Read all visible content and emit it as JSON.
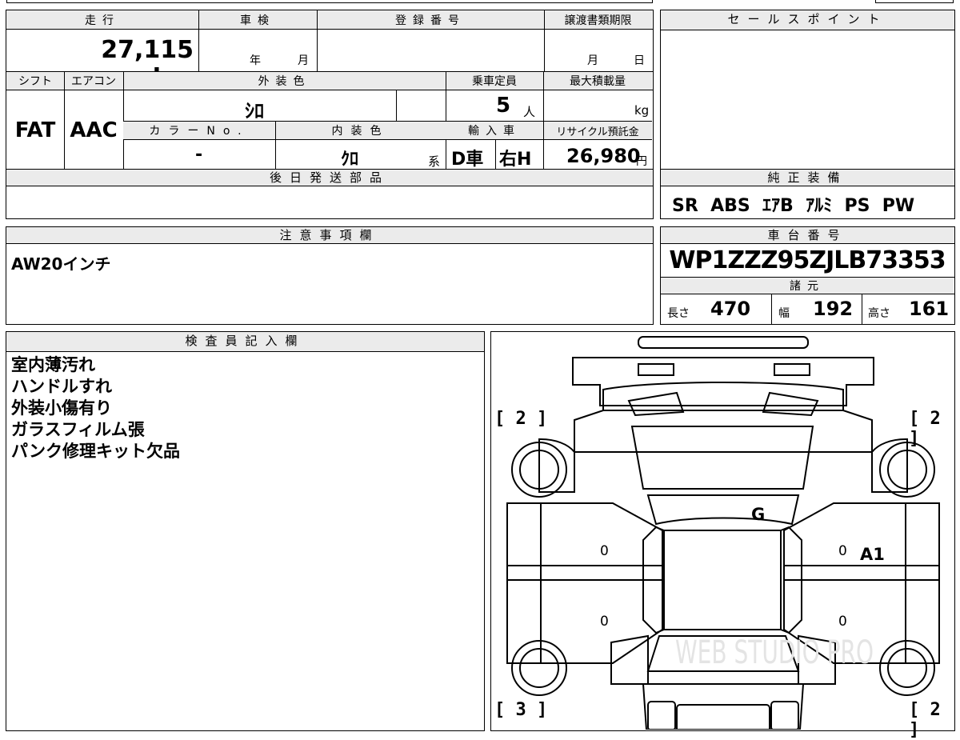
{
  "headers": {
    "mileage": "走行",
    "inspection": "車検",
    "registration_no": "登録番号",
    "transfer_deadline": "譲渡書類期限",
    "sales_points": "セールスポイント",
    "shift": "シフト",
    "aircon": "エアコン",
    "exterior_color": "外装色",
    "capacity": "乗車定員",
    "max_load": "最大積載量",
    "color_no": "カラーNo.",
    "interior_color": "内装色",
    "import": "輸入車",
    "recycle": "リサイクル預託金",
    "later_parts": "後日発送部品",
    "genuine_equipment": "純正装備",
    "notes": "注意事項欄",
    "chassis_no": "車台番号",
    "specs": "諸元",
    "inspector": "検査員記入欄"
  },
  "vehicle": {
    "mileage": "27,115 km",
    "inspection_year_unit": "年",
    "inspection_month_unit": "月",
    "deadline_month_unit": "月",
    "deadline_day_unit": "日",
    "shift": "FAT",
    "aircon": "AAC",
    "exterior_color": "ｼﾛ",
    "capacity": "5",
    "capacity_unit": "人",
    "max_load_unit": "kg",
    "color_no": "-",
    "interior_color": "ｸﾛ",
    "interior_suffix": "系",
    "import_type": "D車",
    "steering": "右H",
    "recycle_fee": "26,980",
    "recycle_unit": "円",
    "equipment": "SR  ABS  ｴｱB  ｱﾙﾐ  PS  PW",
    "notes": "AW20インチ",
    "chassis_no": "WP1ZZZ95ZJLB73353",
    "length_label": "長さ",
    "length": "470",
    "width_label": "幅",
    "width": "192",
    "height_label": "高さ",
    "height": "161"
  },
  "inspector_notes": [
    "室内薄汚れ",
    "ハンドルすれ",
    "外装小傷有り",
    "ガラスフィルム張",
    "パンク修理キット欠品"
  ],
  "diagram": {
    "tire_front_left": "[ 2 ]",
    "tire_front_right": "[ 2 ]",
    "tire_rear_left": "[ 3 ]",
    "tire_rear_right": "[ 2 ]",
    "mark_roof": "G",
    "mark_right_door": "A1",
    "zero": "0",
    "watermark": "WEB STUDIO PRO"
  }
}
